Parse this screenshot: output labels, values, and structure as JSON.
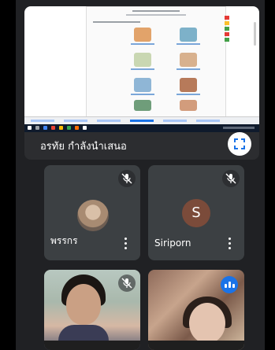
{
  "presentation": {
    "label": "อรทัย กำลังนำเสนอ",
    "fullscreen_icon": "fullscreen-icon"
  },
  "participants": [
    {
      "name": "พรรกร",
      "mic": "muted",
      "avatar": "photo"
    },
    {
      "name": "Siriporn",
      "mic": "muted",
      "avatar": "letter",
      "initial": "S",
      "avatar_color": "#7b4b3a"
    },
    {
      "name": "",
      "mic": "muted",
      "avatar": "video"
    },
    {
      "name": "",
      "mic": "speaking",
      "avatar": "video"
    }
  ],
  "colors": {
    "tile_bg": "#3c4043",
    "app_bg": "#202124",
    "speaking": "#1a73e8"
  }
}
